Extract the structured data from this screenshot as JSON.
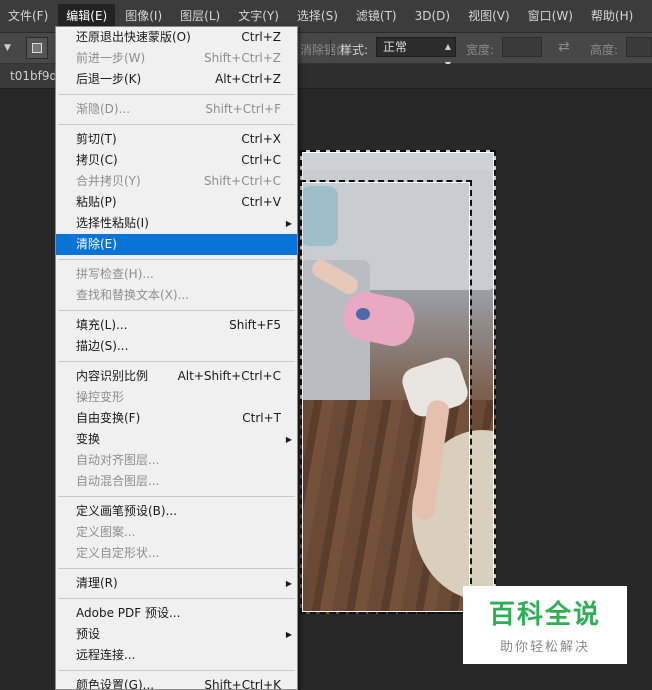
{
  "menubar": {
    "items": [
      "文件(F)",
      "编辑(E)",
      "图像(I)",
      "图层(L)",
      "文字(Y)",
      "选择(S)",
      "滤镜(T)",
      "3D(D)",
      "视图(V)",
      "窗口(W)",
      "帮助(H)"
    ]
  },
  "options": {
    "anti_alias": "消除锯齿",
    "style_label": "样式:",
    "style_value": "正常",
    "width_label": "宽度:",
    "height_label": "高度:"
  },
  "document": {
    "tab_title": "t01bf9d"
  },
  "watermark": {
    "title": "百科全说",
    "subtitle": "助你轻松解决"
  },
  "edit_menu": {
    "items": [
      {
        "label": "还原退出快速蒙版(O)",
        "shortcut": "Ctrl+Z",
        "disabled": false
      },
      {
        "label": "前进一步(W)",
        "shortcut": "Shift+Ctrl+Z",
        "disabled": true
      },
      {
        "label": "后退一步(K)",
        "shortcut": "Alt+Ctrl+Z",
        "disabled": false
      },
      {
        "sep": true
      },
      {
        "label": "渐隐(D)...",
        "shortcut": "Shift+Ctrl+F",
        "disabled": true
      },
      {
        "sep": true
      },
      {
        "label": "剪切(T)",
        "shortcut": "Ctrl+X",
        "disabled": false
      },
      {
        "label": "拷贝(C)",
        "shortcut": "Ctrl+C",
        "disabled": false
      },
      {
        "label": "合并拷贝(Y)",
        "shortcut": "Shift+Ctrl+C",
        "disabled": true
      },
      {
        "label": "粘贴(P)",
        "shortcut": "Ctrl+V",
        "disabled": false
      },
      {
        "label": "选择性粘贴(I)",
        "shortcut": "",
        "disabled": false,
        "submenu": true
      },
      {
        "label": "清除(E)",
        "shortcut": "",
        "disabled": false,
        "highlight": true
      },
      {
        "sep": true
      },
      {
        "label": "拼写检查(H)...",
        "shortcut": "",
        "disabled": true
      },
      {
        "label": "查找和替换文本(X)...",
        "shortcut": "",
        "disabled": true
      },
      {
        "sep": true
      },
      {
        "label": "填充(L)...",
        "shortcut": "Shift+F5",
        "disabled": false
      },
      {
        "label": "描边(S)...",
        "shortcut": "",
        "disabled": false
      },
      {
        "sep": true
      },
      {
        "label": "内容识别比例",
        "shortcut": "Alt+Shift+Ctrl+C",
        "disabled": false
      },
      {
        "label": "操控变形",
        "shortcut": "",
        "disabled": true
      },
      {
        "label": "自由变换(F)",
        "shortcut": "Ctrl+T",
        "disabled": false
      },
      {
        "label": "变换",
        "shortcut": "",
        "disabled": false,
        "submenu": true
      },
      {
        "label": "自动对齐图层...",
        "shortcut": "",
        "disabled": true
      },
      {
        "label": "自动混合图层...",
        "shortcut": "",
        "disabled": true
      },
      {
        "sep": true
      },
      {
        "label": "定义画笔预设(B)...",
        "shortcut": "",
        "disabled": false
      },
      {
        "label": "定义图案...",
        "shortcut": "",
        "disabled": true
      },
      {
        "label": "定义自定形状...",
        "shortcut": "",
        "disabled": true
      },
      {
        "sep": true
      },
      {
        "label": "清理(R)",
        "shortcut": "",
        "disabled": false,
        "submenu": true
      },
      {
        "sep": true
      },
      {
        "label": "Adobe PDF 预设...",
        "shortcut": "",
        "disabled": false
      },
      {
        "label": "预设",
        "shortcut": "",
        "disabled": false,
        "submenu": true
      },
      {
        "label": "远程连接...",
        "shortcut": "",
        "disabled": false
      },
      {
        "sep": true
      },
      {
        "label": "颜色设置(G)...",
        "shortcut": "Shift+Ctrl+K",
        "disabled": false
      }
    ]
  }
}
